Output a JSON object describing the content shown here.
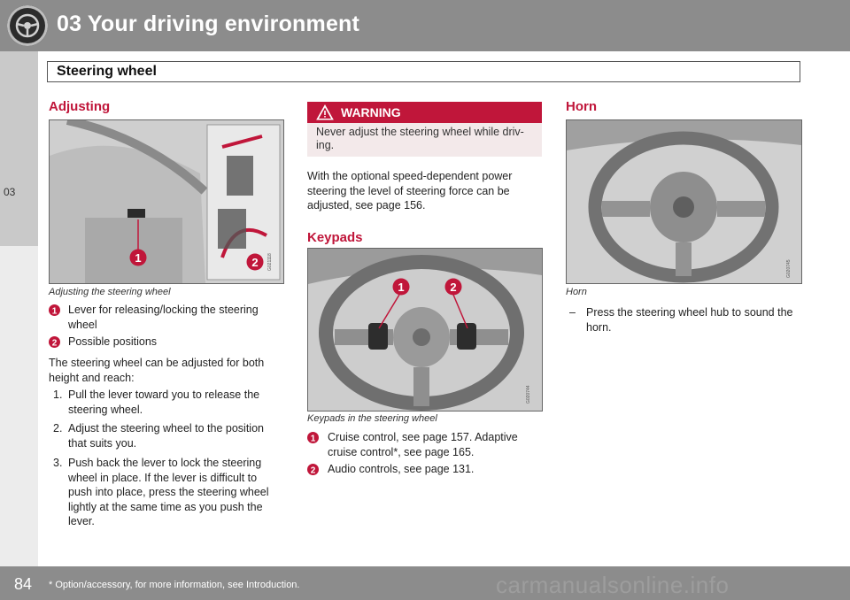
{
  "header": {
    "chapter_title": "03 Your driving environment",
    "chapter_number": "03"
  },
  "section": {
    "title": "Steering wheel"
  },
  "adjusting": {
    "heading": "Adjusting",
    "figure_code": "G021118",
    "caption": "Adjusting the steering wheel",
    "legend": [
      {
        "num": "1",
        "text": "Lever for releasing/locking the steering wheel"
      },
      {
        "num": "2",
        "text": "Possible positions"
      }
    ],
    "intro": "The steering wheel can be adjusted for both height and reach:",
    "steps": [
      {
        "num": "1.",
        "text": "Pull the lever toward you to release the steering wheel."
      },
      {
        "num": "2.",
        "text": "Adjust the steering wheel to the position that suits you."
      },
      {
        "num": "3.",
        "text": "Push back the lever to lock the steering wheel in place. If the lever is difficult to push into place, press the steering wheel lightly at the same time as you push the lever."
      }
    ]
  },
  "warning": {
    "title": "WARNING",
    "text": "Never adjust the steering wheel while driv-ing."
  },
  "middle": {
    "text": "With the optional speed-dependent power steering the level of steering force can be adjusted, see page 156."
  },
  "keypads": {
    "heading": "Keypads",
    "figure_code": "G020744",
    "caption": "Keypads in the steering wheel",
    "legend": [
      {
        "num": "1",
        "text": "Cruise control, see page 157. Adaptive cruise control*, see page 165."
      },
      {
        "num": "2",
        "text": "Audio controls, see page 131."
      }
    ]
  },
  "horn": {
    "heading": "Horn",
    "figure_code": "G020745",
    "caption": "Horn",
    "bullet": "–",
    "text": "Press the steering wheel hub to sound the horn."
  },
  "footer": {
    "page_number": "84",
    "footnote": "* Option/accessory, for more information, see Introduction.",
    "watermark": "carmanualsonline.info"
  },
  "colors": {
    "accent": "#c0163a",
    "header_gray": "#8c8c8c",
    "warning_bg": "#f3e9ea"
  }
}
